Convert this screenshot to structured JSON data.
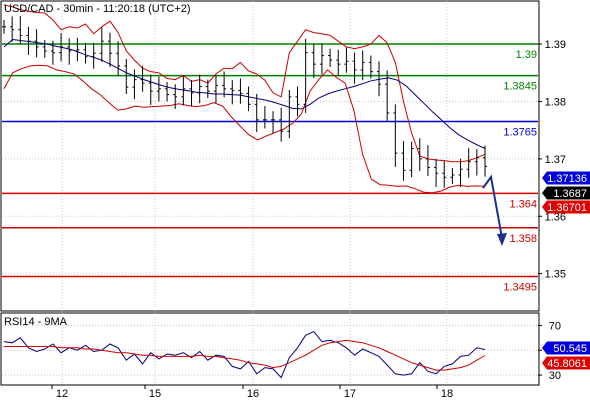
{
  "chart_data": {
    "type": "line",
    "title": "USD/CAD - 30min - 11:20:18 (UTC+2)",
    "x_ticks": [
      "12",
      "15",
      "16",
      "17",
      "18"
    ],
    "price_panel": {
      "ylim": [
        1.3435,
        1.3975
      ],
      "y_ticks": [
        "1.39",
        "1.38",
        "1.37",
        "1.36",
        "1.35"
      ],
      "levels": [
        {
          "label": "1.39",
          "value": 1.39,
          "color": "#008000"
        },
        {
          "label": "1.3845",
          "value": 1.3845,
          "color": "#008000"
        },
        {
          "label": "1.3765",
          "value": 1.3765,
          "color": "#0000cc"
        },
        {
          "label": "1.364",
          "value": 1.364,
          "color": "#cc0000"
        },
        {
          "label": "1.358",
          "value": 1.358,
          "color": "#cc0000"
        },
        {
          "label": "1.3495",
          "value": 1.3495,
          "color": "#cc0000"
        }
      ],
      "tags": [
        {
          "label": "1.37136",
          "value": 1.37136,
          "color": "#0000dd"
        },
        {
          "label": "1.3687",
          "value": 1.3687,
          "color": "#000000"
        },
        {
          "label": "1.36701",
          "value": 1.36701,
          "color": "#dd0000"
        }
      ],
      "close": [
        1.393,
        1.3925,
        1.3915,
        1.3905,
        1.3895,
        1.3888,
        1.3885,
        1.3895,
        1.3888,
        1.389,
        1.3878,
        1.3884,
        1.3905,
        1.3884,
        1.3862,
        1.3825,
        1.3838,
        1.3832,
        1.3818,
        1.3822,
        1.3812,
        1.3808,
        1.3822,
        1.3815,
        1.3826,
        1.3818,
        1.3828,
        1.3822,
        1.3819,
        1.3814,
        1.3795,
        1.3768,
        1.3768,
        1.3768,
        1.3748,
        1.3808,
        1.3795,
        1.3885,
        1.3865,
        1.388,
        1.3872,
        1.3865,
        1.387,
        1.3855,
        1.3868,
        1.3852,
        1.383,
        1.378,
        1.371,
        1.368,
        1.3718,
        1.37,
        1.3685,
        1.3675,
        1.3668,
        1.3672,
        1.3682,
        1.3695,
        1.3702,
        1.3687
      ],
      "series": [
        {
          "name": "upper-band",
          "color": "#cc0000",
          "values": [
            1.3968,
            1.3965,
            1.396,
            1.3957,
            1.3955,
            1.3954,
            1.3942,
            1.3925,
            1.393,
            1.3928,
            1.3935,
            1.3918,
            1.393,
            1.394,
            1.392,
            1.3888,
            1.3872,
            1.3858,
            1.3852,
            1.385,
            1.384,
            1.3838,
            1.3845,
            1.3835,
            1.3838,
            1.3832,
            1.3848,
            1.3858,
            1.3857,
            1.3868,
            1.3853,
            1.3848,
            1.3837,
            1.3815,
            1.3808,
            1.3885,
            1.3905,
            1.3925,
            1.392,
            1.3918,
            1.3915,
            1.3905,
            1.3895,
            1.3892,
            1.3895,
            1.39,
            1.3915,
            1.3902,
            1.3868,
            1.38,
            1.3745,
            1.3705,
            1.37,
            1.3698,
            1.3697,
            1.3695,
            1.3695,
            1.3697,
            1.3702,
            1.3708
          ]
        },
        {
          "name": "moving-average",
          "color": "#000080",
          "values": [
            1.3895,
            1.3908,
            1.3906,
            1.3904,
            1.3902,
            1.39,
            1.3896,
            1.3893,
            1.3889,
            1.3883,
            1.3878,
            1.3873,
            1.3866,
            1.3858,
            1.385,
            1.3844,
            1.3838,
            1.3833,
            1.3828,
            1.3824,
            1.3821,
            1.3819,
            1.3816,
            1.3815,
            1.3813,
            1.3813,
            1.3812,
            1.3811,
            1.3808,
            1.3805,
            1.3802,
            1.3798,
            1.3793,
            1.3788,
            1.3787,
            1.3795,
            1.3806,
            1.3813,
            1.3818,
            1.3822,
            1.3826,
            1.3831,
            1.3836,
            1.3839,
            1.3841,
            1.3837,
            1.3827,
            1.3812,
            1.3797,
            1.3782,
            1.3768,
            1.3754,
            1.3742,
            1.3733,
            1.3725,
            1.3718
          ]
        },
        {
          "name": "lower-band",
          "color": "#cc0000",
          "values": [
            1.3822,
            1.385,
            1.3857,
            1.3862,
            1.3863,
            1.3862,
            1.3855,
            1.3852,
            1.3848,
            1.3836,
            1.3822,
            1.3812,
            1.3798,
            1.3785,
            1.3787,
            1.3792,
            1.379,
            1.3791,
            1.3792,
            1.3793,
            1.3796,
            1.3793,
            1.3791,
            1.3793,
            1.3798,
            1.3792,
            1.3773,
            1.3757,
            1.3742,
            1.3733,
            1.374,
            1.3746,
            1.3752,
            1.3762,
            1.3778,
            1.3818,
            1.3838,
            1.3855,
            1.3842,
            1.3832,
            1.3785,
            1.3708,
            1.3665,
            1.3655,
            1.3654,
            1.3652,
            1.3653,
            1.3648,
            1.3642,
            1.3641,
            1.3644,
            1.3651,
            1.3654,
            1.3652,
            1.3653,
            1.3652
          ]
        }
      ]
    },
    "rsi_panel": {
      "title": "RSI14 - 9MA",
      "ylim": [
        22,
        80
      ],
      "y_ticks": [
        "70",
        "50",
        "30"
      ],
      "tags": [
        {
          "label": "50.545",
          "value": 50.545,
          "color": "#0000dd"
        },
        {
          "label": "45.8061",
          "value": 45.8061,
          "color": "#dd0000"
        }
      ],
      "series": [
        {
          "name": "RSI14",
          "color": "#000080",
          "values": [
            57,
            56,
            60,
            52,
            49,
            51,
            55,
            48,
            52,
            50,
            54,
            49,
            50,
            55,
            52,
            42,
            47,
            39,
            48,
            43,
            47,
            46,
            48,
            44,
            49,
            42,
            46,
            45,
            37,
            35,
            41,
            31,
            36,
            35,
            28,
            44,
            52,
            62,
            65,
            57,
            58,
            56,
            52,
            46,
            51,
            48,
            45,
            38,
            31,
            30,
            31,
            40,
            33,
            31,
            37,
            39,
            45,
            46,
            52,
            50.5
          ]
        },
        {
          "name": "9MA",
          "color": "#cc0000",
          "values": [
            53,
            53,
            53,
            53,
            53,
            53,
            53,
            52,
            52,
            52,
            51,
            51,
            50,
            49,
            48,
            48,
            47,
            46,
            46,
            45,
            45,
            45,
            45,
            45,
            46,
            45,
            45,
            44,
            43,
            42,
            40,
            39,
            38,
            36,
            37,
            40,
            43,
            46,
            50,
            54,
            56,
            57,
            58,
            57,
            56,
            54,
            52,
            49,
            46,
            43,
            40,
            38,
            36,
            34,
            34,
            35,
            36,
            38,
            42,
            45.8
          ]
        }
      ]
    }
  }
}
